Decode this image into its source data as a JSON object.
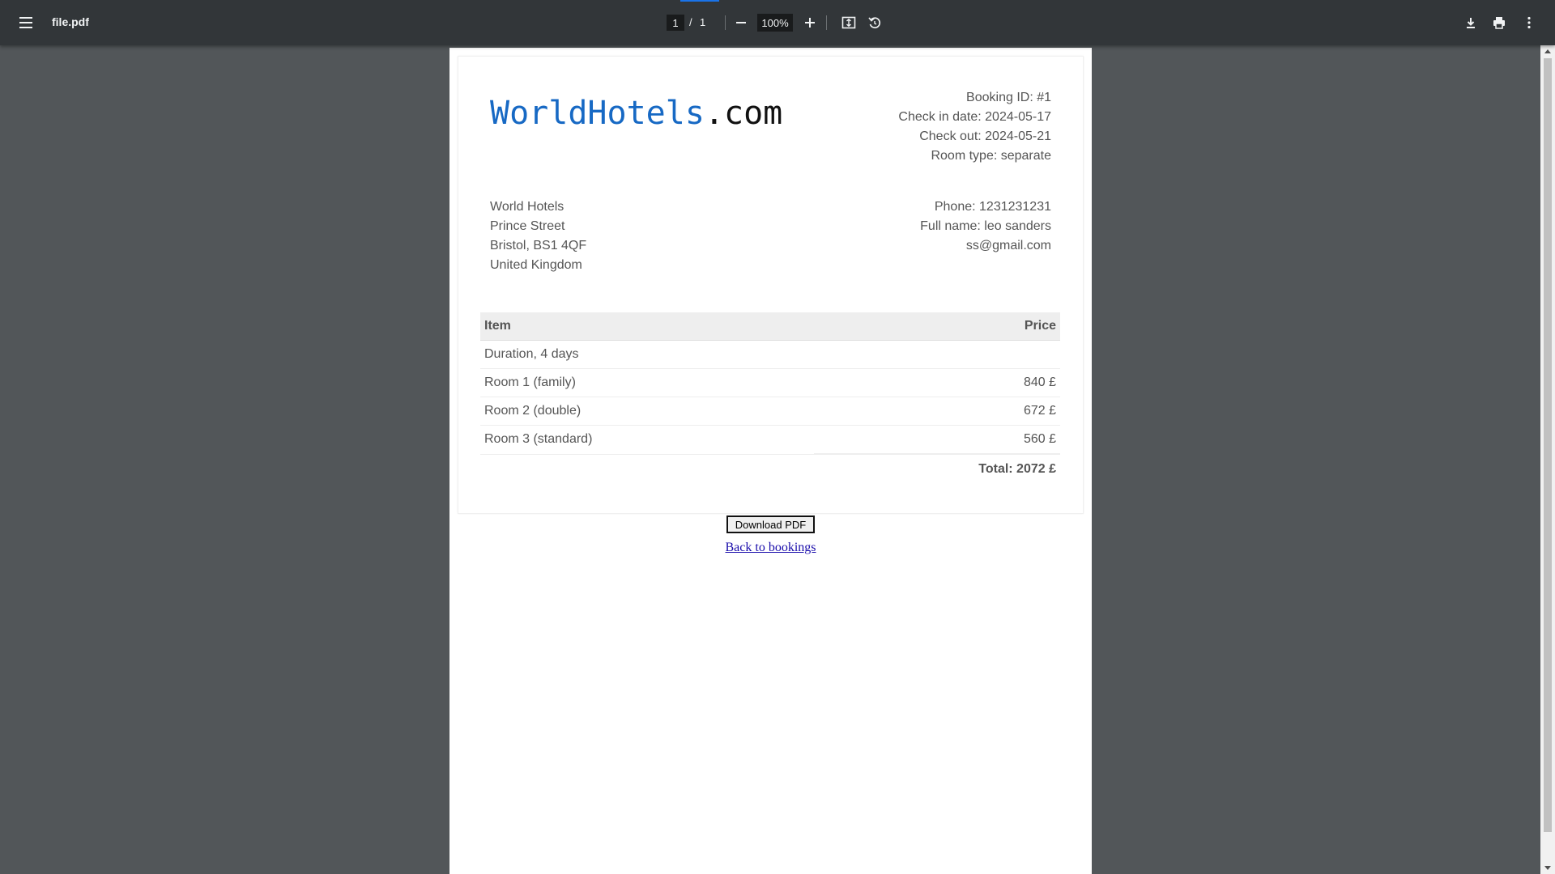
{
  "toolbar": {
    "filename": "file.pdf",
    "page_current": "1",
    "page_separator": "/",
    "page_total": "1",
    "zoom": "100%",
    "icons": [
      "menu-icon",
      "zoom-out-icon",
      "zoom-in-icon",
      "fit-to-page-icon",
      "rotate-icon",
      "download-icon",
      "print-icon",
      "more-icon"
    ]
  },
  "document": {
    "logo": {
      "main": "WorldHotels",
      "tld": ".com"
    },
    "booking": {
      "id": "Booking ID: #1",
      "check_in": "Check in date: 2024-05-17",
      "check_out": "Check out: 2024-05-21",
      "room_type": "Room type: separate"
    },
    "company": {
      "name": "World Hotels",
      "street": "Prince Street",
      "city": "Bristol, BS1 4QF",
      "country": "United Kingdom"
    },
    "customer": {
      "phone": "Phone: 1231231231",
      "full_name": "Full name: leo sanders",
      "email": "ss@gmail.com"
    },
    "table": {
      "headers": {
        "item": "Item",
        "price": "Price"
      },
      "rows": [
        {
          "item": "Duration, 4 days",
          "price": ""
        },
        {
          "item": "Room 1 (family)",
          "price": "840 £"
        },
        {
          "item": "Room 2 (double)",
          "price": "672 £"
        },
        {
          "item": "Room 3 (standard)",
          "price": "560 £"
        }
      ],
      "total": "Total: 2072 £"
    },
    "download_button": "Download  PDF",
    "back_link": "Back to bookings"
  },
  "colors": {
    "toolbar_bg": "#323639",
    "viewer_bg": "#525659",
    "logo_blue": "#1769c4",
    "link": "#1a0dab"
  }
}
